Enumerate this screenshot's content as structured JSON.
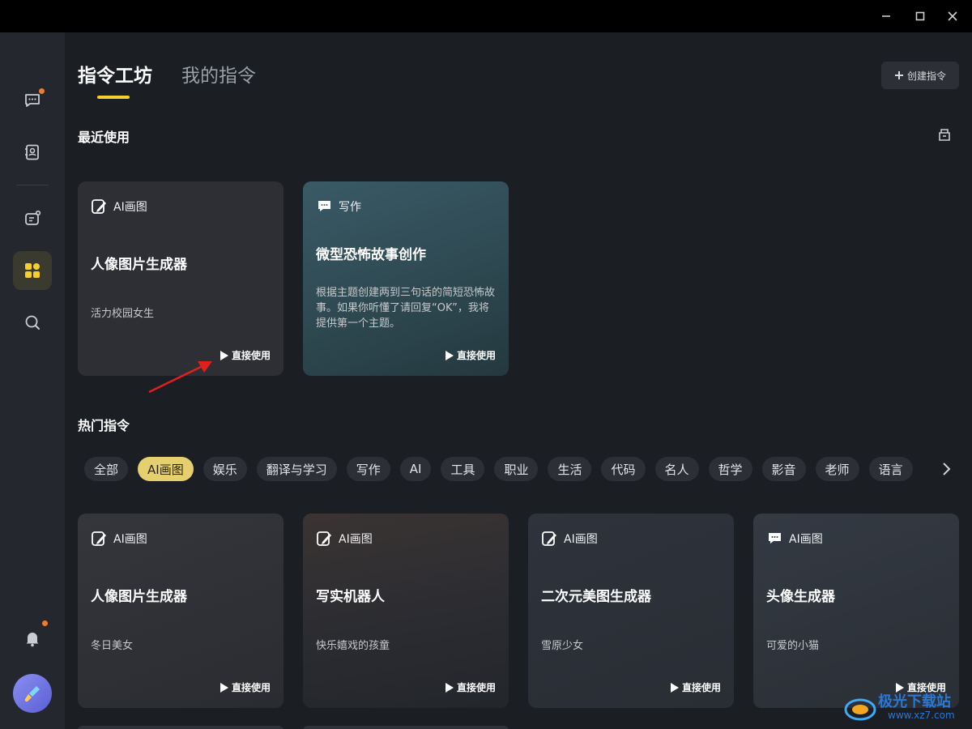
{
  "tabs": {
    "active": "指令工坊",
    "inactive": "我的指令"
  },
  "create_button": "创建指令",
  "sections": {
    "recent": "最近使用",
    "hot": "热门指令"
  },
  "recent_cards": [
    {
      "category": "AI画图",
      "title": "人像图片生成器",
      "desc": "活力校园女生",
      "action": "直接使用",
      "icon": "pencil-icon"
    },
    {
      "category": "写作",
      "title": "微型恐怖故事创作",
      "desc": "根据主题创建两到三句话的简短恐怖故事。如果你听懂了请回复“OK”，我将提供第一个主题。",
      "action": "直接使用",
      "icon": "chat-icon"
    }
  ],
  "chips": [
    "全部",
    "AI画图",
    "娱乐",
    "翻译与学习",
    "写作",
    "AI",
    "工具",
    "职业",
    "生活",
    "代码",
    "名人",
    "哲学",
    "影音",
    "老师",
    "语言"
  ],
  "chips_active_index": 1,
  "hot_cards": [
    {
      "category": "AI画图",
      "title": "人像图片生成器",
      "desc": "冬日美女",
      "action": "直接使用",
      "icon": "pencil-icon"
    },
    {
      "category": "AI画图",
      "title": "写实机器人",
      "desc": "快乐嬉戏的孩童",
      "action": "直接使用",
      "icon": "pencil-icon"
    },
    {
      "category": "AI画图",
      "title": "二次元美图生成器",
      "desc": "雪原少女",
      "action": "直接使用",
      "icon": "pencil-icon"
    },
    {
      "category": "AI画图",
      "title": "头像生成器",
      "desc": "可爱的小猫",
      "action": "直接使用",
      "icon": "chat-icon"
    }
  ],
  "watermark": {
    "text": "极光下载站",
    "url": "www.xz7.com"
  },
  "colors": {
    "accent": "#f5cf2e",
    "chip_active": "#e6cf6e",
    "notify_dot": "#f07c2b"
  }
}
